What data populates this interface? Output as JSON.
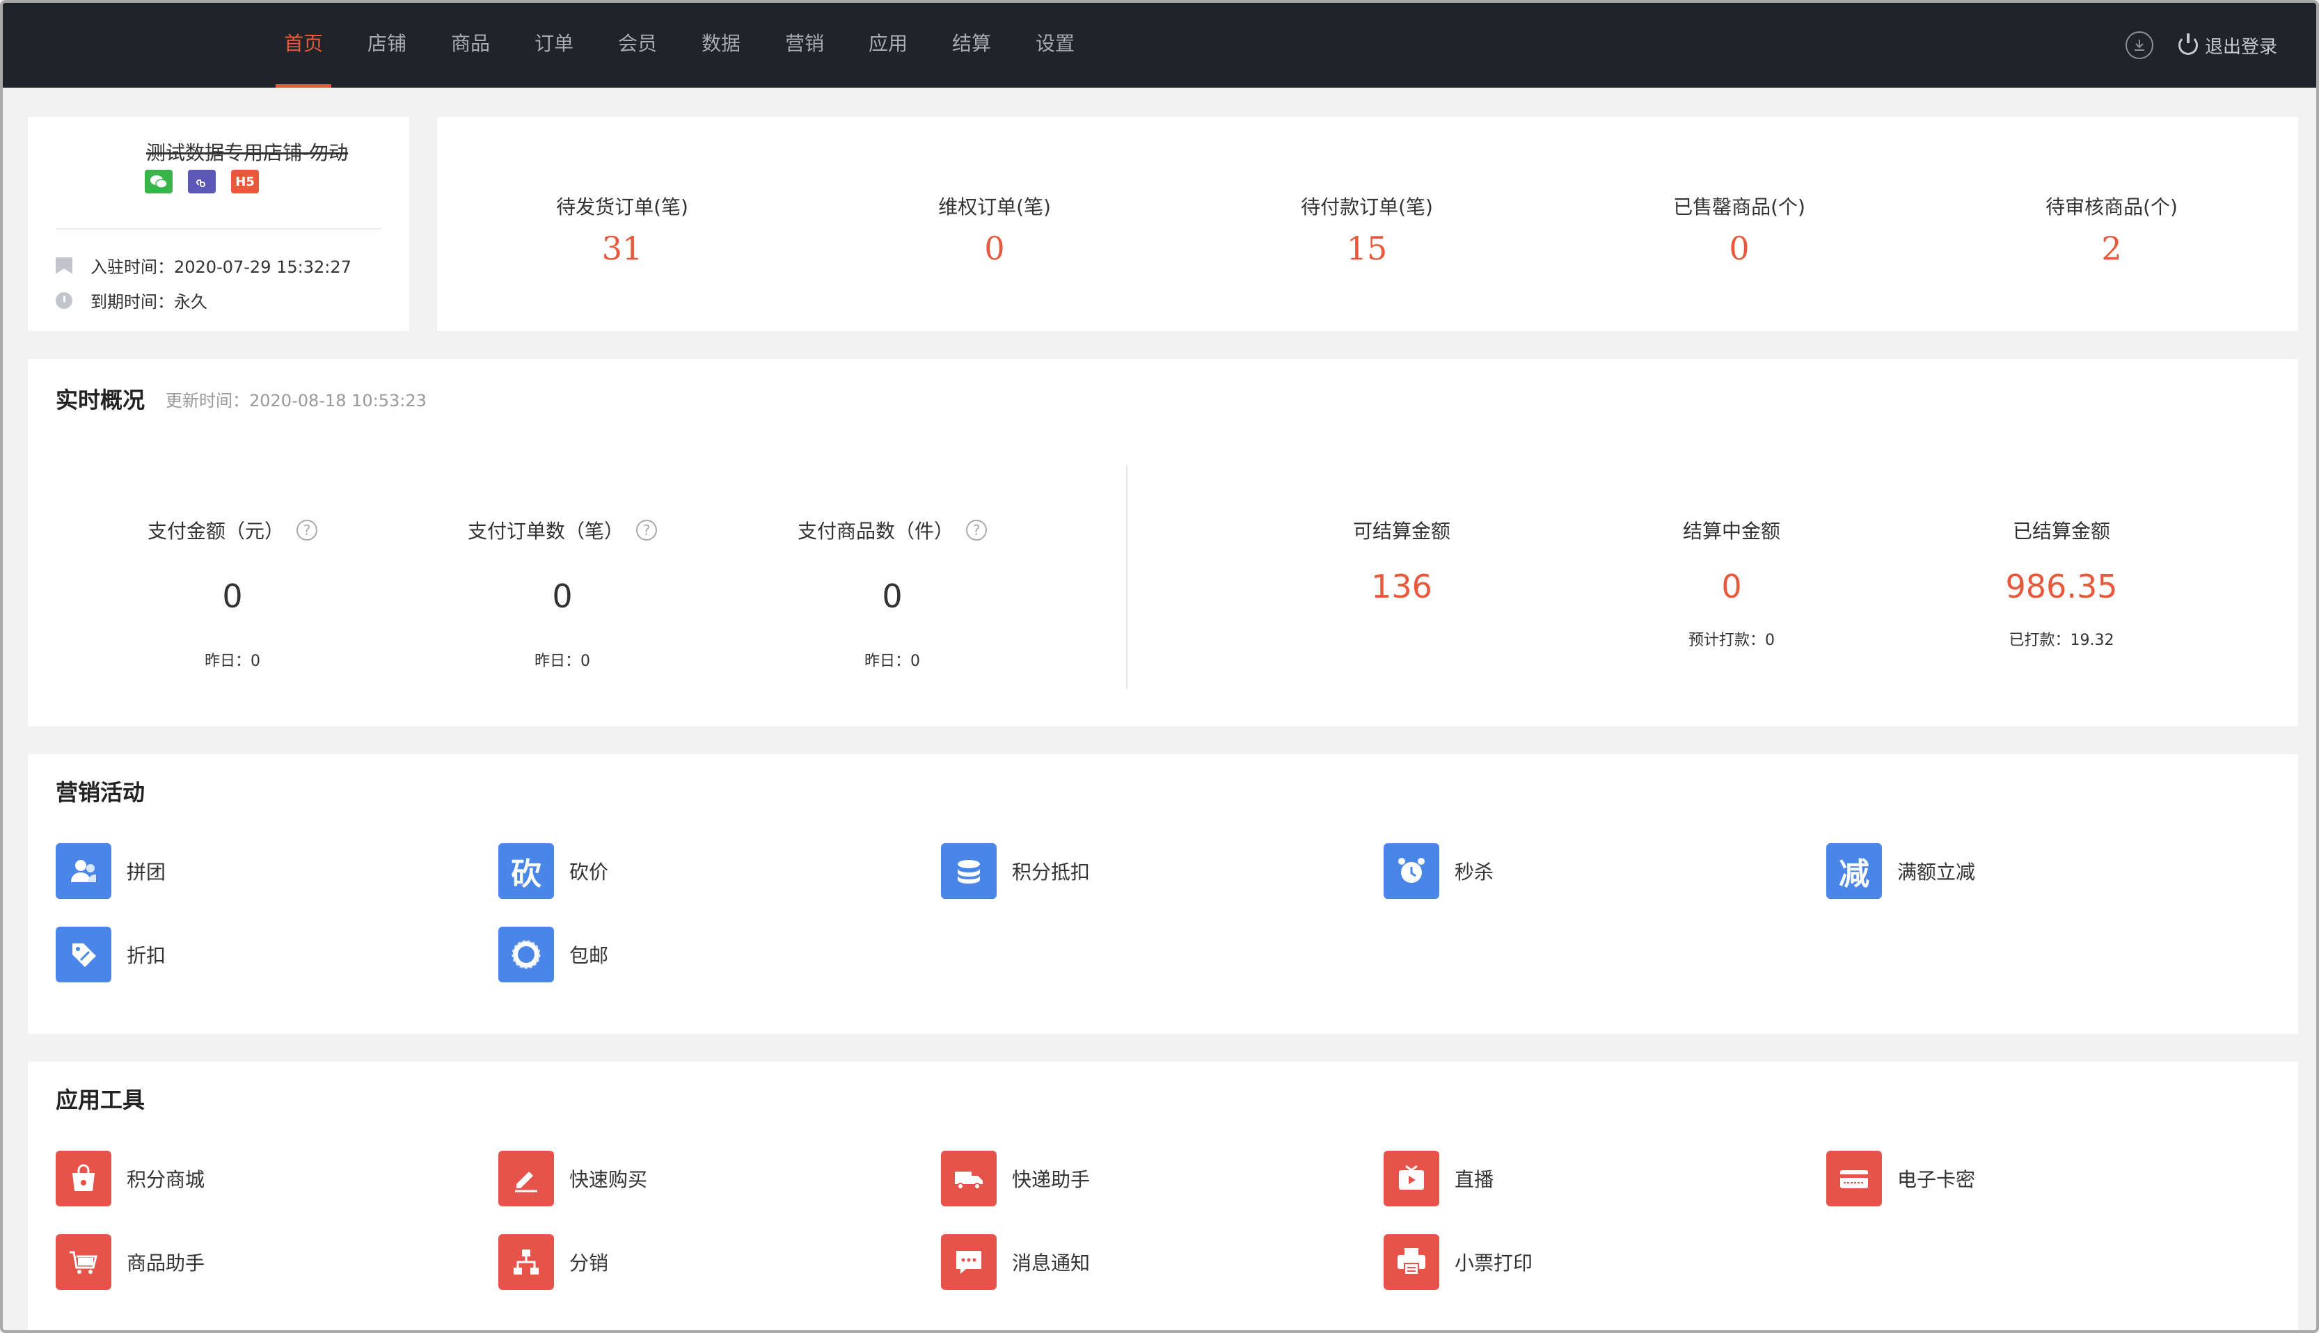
{
  "nav": {
    "items": [
      "首页",
      "店铺",
      "商品",
      "订单",
      "会员",
      "数据",
      "营销",
      "应用",
      "结算",
      "设置"
    ],
    "active_index": 0,
    "logout_label": "退出登录"
  },
  "store": {
    "name": "测试数据专用店铺-勿动",
    "badges": [
      "wechat",
      "mini-program",
      "H5"
    ],
    "h5_label": "H5",
    "join_time_label": "入驻时间：2020-07-29 15:32:27",
    "expire_label": "到期时间：永久"
  },
  "stats": [
    {
      "label": "待发货订单(笔)",
      "value": "31"
    },
    {
      "label": "维权订单(笔)",
      "value": "0"
    },
    {
      "label": "待付款订单(笔)",
      "value": "15"
    },
    {
      "label": "已售罄商品(个)",
      "value": "0"
    },
    {
      "label": "待审核商品(个)",
      "value": "2"
    }
  ],
  "realtime": {
    "title": "实时概况",
    "update_time": "更新时间：2020-08-18 10:53:23",
    "left": [
      {
        "label": "支付金额（元）",
        "value": "0",
        "sub": "昨日：0"
      },
      {
        "label": "支付订单数（笔）",
        "value": "0",
        "sub": "昨日：0"
      },
      {
        "label": "支付商品数（件）",
        "value": "0",
        "sub": "昨日：0"
      }
    ],
    "right": [
      {
        "label": "可结算金额",
        "value": "136",
        "sub": ""
      },
      {
        "label": "结算中金额",
        "value": "0",
        "sub": "预计打款：0"
      },
      {
        "label": "已结算金额",
        "value": "986.35",
        "sub": "已打款：19.32"
      }
    ],
    "help_glyph": "?"
  },
  "marketing": {
    "title": "营销活动",
    "items": [
      {
        "label": "拼团",
        "icon": "group-buy-icon",
        "glyph": "👥"
      },
      {
        "label": "砍价",
        "icon": "bargain-icon",
        "glyph": "砍"
      },
      {
        "label": "积分抵扣",
        "icon": "points-deduct-icon",
        "glyph": "◎"
      },
      {
        "label": "秒杀",
        "icon": "flash-sale-icon",
        "glyph": "⏰"
      },
      {
        "label": "满额立减",
        "icon": "full-reduction-icon",
        "glyph": "减"
      },
      {
        "label": "折扣",
        "icon": "discount-tag-icon",
        "glyph": "✎"
      },
      {
        "label": "包邮",
        "icon": "free-shipping-icon",
        "glyph": "包邮"
      }
    ]
  },
  "tools": {
    "title": "应用工具",
    "items": [
      {
        "label": "积分商城",
        "icon": "points-mall-icon",
        "glyph": "🛍"
      },
      {
        "label": "快速购买",
        "icon": "quick-buy-icon",
        "glyph": "✍"
      },
      {
        "label": "快递助手",
        "icon": "express-truck-icon",
        "glyph": "🚚"
      },
      {
        "label": "直播",
        "icon": "live-stream-icon",
        "glyph": "▶"
      },
      {
        "label": "电子卡密",
        "icon": "e-card-icon",
        "glyph": "▭"
      },
      {
        "label": "商品助手",
        "icon": "product-assistant-icon",
        "glyph": "助手"
      },
      {
        "label": "分销",
        "icon": "distribution-icon",
        "glyph": "品"
      },
      {
        "label": "消息通知",
        "icon": "message-icon",
        "glyph": "…"
      },
      {
        "label": "小票打印",
        "icon": "receipt-printer-icon",
        "glyph": "🖨"
      }
    ]
  },
  "colors": {
    "accent": "#e8593b",
    "nav_bg": "#20232a",
    "marketing_tile": "#4a86e8",
    "tool_tile": "#e5534b"
  }
}
